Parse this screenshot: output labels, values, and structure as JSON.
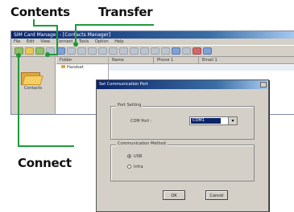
{
  "callouts": {
    "contents": "Contents",
    "transfer": "Transfer",
    "connect": "Connect"
  },
  "app": {
    "title": "SIM Card Manager - [Contacts Manager]",
    "menu": [
      "File",
      "Edit",
      "View",
      "Connect",
      "Tools",
      "Option",
      "Help"
    ],
    "left_label": "Contacts",
    "folder_header": "Folder",
    "tree_item": "Handset",
    "columns": [
      "Name",
      "Phone 1",
      "Email 1"
    ]
  },
  "dialog": {
    "title": "Set Communication Port",
    "port_group": "Port Setting",
    "port_label": "COM Port :",
    "port_value": "COM1",
    "method_group": "Communication Method",
    "method_options": [
      "USB",
      "Infra"
    ],
    "ok": "OK",
    "cancel": "Cancel"
  },
  "colors": {
    "leader": "#1f9a3a",
    "titlebar": "#0a246a",
    "window_bg": "#d4d0c8"
  }
}
